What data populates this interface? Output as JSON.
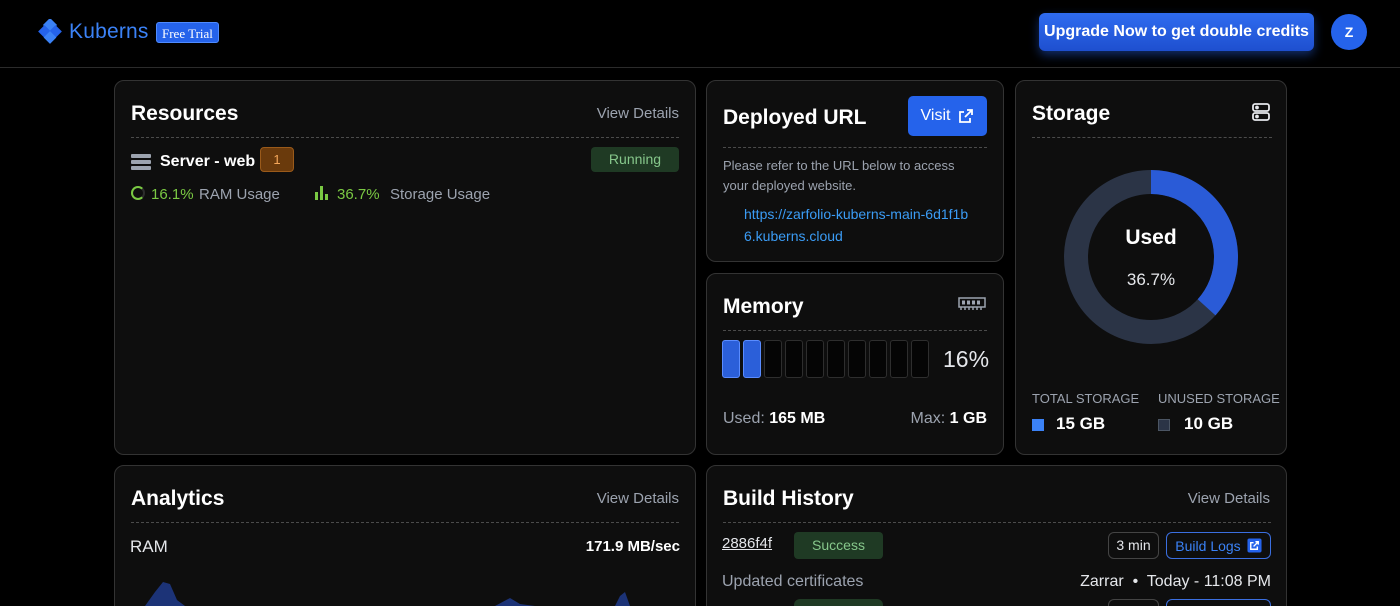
{
  "header": {
    "brand": "Kuberns",
    "trial_badge": "Free Trial",
    "upgrade_label": "Upgrade Now to get double credits",
    "avatar_initial": "Z"
  },
  "resources": {
    "title": "Resources",
    "view_details": "View Details",
    "server_name": "Server - web",
    "count": "1",
    "status": "Running",
    "ram_value": "16.1%",
    "ram_label": "RAM Usage",
    "storage_value": "36.7%",
    "storage_label": "Storage Usage"
  },
  "deployed": {
    "title": "Deployed URL",
    "visit_label": "Visit",
    "description": "Please refer to the URL below to access your deployed website.",
    "url": "https://zarfolio-kuberns-main-6d1f1b6.kuberns.cloud"
  },
  "memory": {
    "title": "Memory",
    "percent": "16%",
    "used_fraction": 0.16,
    "used_label": "Used:",
    "used_value": "165 MB",
    "max_label": "Max:",
    "max_value": "1 GB"
  },
  "storage": {
    "title": "Storage",
    "center_label": "Used",
    "center_value": "36.7%",
    "used_fraction": 0.367,
    "total_label": "TOTAL STORAGE",
    "total_value": "15 GB",
    "unused_label": "UNUSED STORAGE",
    "unused_value": "10 GB",
    "colors": {
      "used": "#2a5bd7",
      "unused": "#2b3446"
    }
  },
  "analytics": {
    "title": "Analytics",
    "view_details": "View Details",
    "metric_label": "RAM",
    "metric_value": "171.9 MB/sec"
  },
  "build_history": {
    "title": "Build History",
    "view_details": "View Details",
    "builds": [
      {
        "commit": "2886f4f",
        "status": "Success",
        "duration": "3 min",
        "logs_label": "Build Logs",
        "message": "Updated certificates",
        "author": "Zarrar",
        "separator": "•",
        "time": "Today - 11:08 PM"
      }
    ]
  },
  "icons": {
    "logo": "kuberns-diamond-icon",
    "server": "server-icon",
    "ram": "ram-ring-icon",
    "storage_bars": "bar-chart-icon",
    "external": "external-link-icon",
    "memory": "memory-chip-icon",
    "storage": "database-icon"
  },
  "colors": {
    "accent": "#2563eb",
    "success": "#86c78b",
    "metric": "#7ac943"
  }
}
